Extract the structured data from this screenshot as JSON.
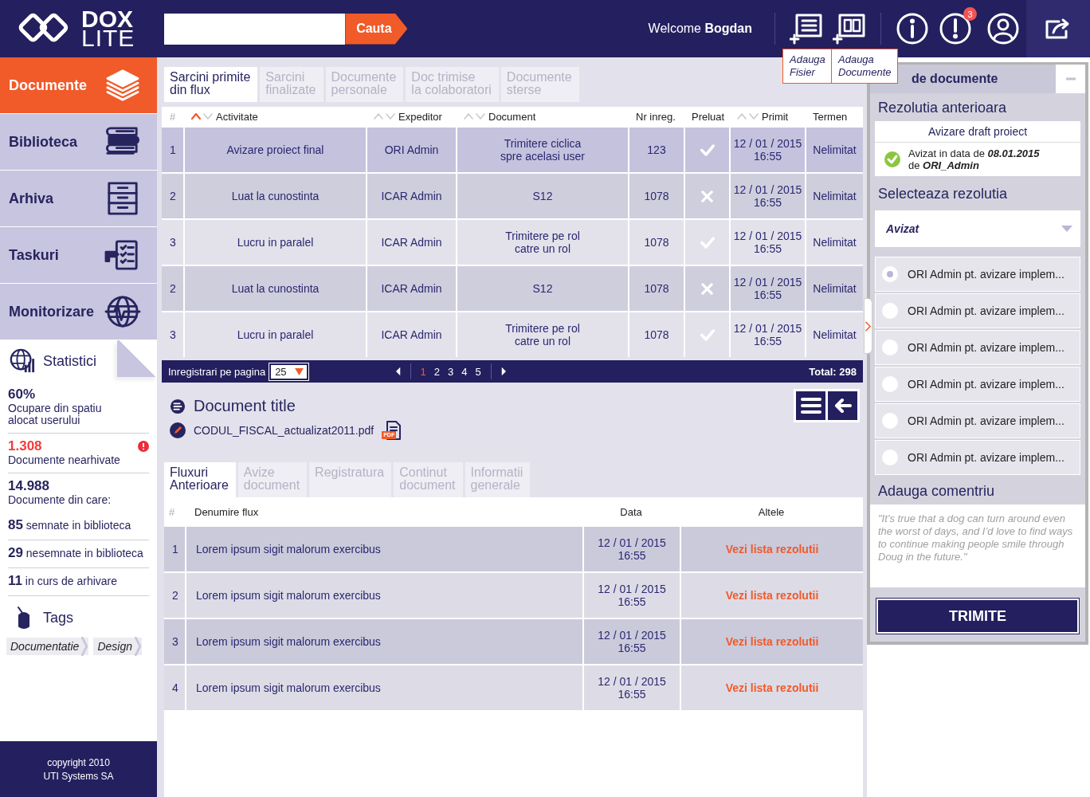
{
  "header": {
    "logo_top": "DOX",
    "logo_bottom": "LITE",
    "search": {
      "button": "Cauta"
    },
    "welcome": "Welcome **Bogdan**",
    "action_groups": [
      {
        "actions": [
          {
            "kind": "add-file",
            "tooltip": "Adauga\nFisier"
          },
          {
            "kind": "add-documents",
            "tooltip": "Adauga\nDocumente"
          }
        ]
      },
      {
        "actions": [
          {
            "kind": "info"
          },
          {
            "kind": "alert",
            "badge": "3"
          },
          {
            "kind": "user"
          }
        ]
      },
      {
        "actions": [
          {
            "kind": "logout"
          }
        ]
      }
    ]
  },
  "sidebar": {
    "items": [
      {
        "label": "Documente",
        "selected": true
      },
      {
        "label": "Biblioteca",
        "selected": false
      },
      {
        "label": "Arhiva",
        "selected": false
      },
      {
        "label": "Taskuri",
        "selected": false
      },
      {
        "label": "Monitorizare",
        "selected": false
      }
    ],
    "stats": {
      "title": "Statistici",
      "items": [
        {
          "kind": "stacked",
          "value": "60%",
          "label": "Ocupare din spatiu\nalocat userului",
          "alert": false,
          "divider": true
        },
        {
          "kind": "stacked",
          "value": "1.308",
          "label": "Documente nearhivate",
          "alert": true,
          "divider": true
        },
        {
          "kind": "stacked",
          "value": "14.988",
          "label": "Documente din care:",
          "alert": false,
          "divider": false
        },
        {
          "kind": "inline",
          "value": "85",
          "label": "semnate in biblioteca",
          "alert": false,
          "divider": true
        },
        {
          "kind": "inline",
          "value": "29",
          "label": "nesemnate in biblioteca",
          "alert": false,
          "divider": true
        },
        {
          "kind": "inline",
          "value": "11",
          "label": "in curs de arhivare",
          "alert": false,
          "divider": true
        }
      ]
    },
    "tags": {
      "title": "Tags",
      "items": [
        "Documentatie",
        "Design"
      ]
    },
    "footer": [
      "copyright 2010",
      "UTI Systems SA"
    ]
  },
  "tasks": {
    "tabs": [
      {
        "label": "Sarcini primite\ndin flux",
        "selected": true
      },
      {
        "label": "Sarcini\nfinalizate",
        "selected": false
      },
      {
        "label": "Documente\npersonale",
        "selected": false
      },
      {
        "label": "Doc trimise\nla colaboratori",
        "selected": false
      },
      {
        "label": "Documente\nsterse",
        "selected": false
      }
    ],
    "columns": [
      {
        "label": "#",
        "sortable": false
      },
      {
        "label": "Activitate",
        "sortable": true,
        "sort_active": true
      },
      {
        "label": "Expeditor",
        "sortable": true,
        "sort_active": false
      },
      {
        "label": "Document",
        "sortable": true,
        "sort_active": false
      },
      {
        "label": "Nr inreg.",
        "sortable": false
      },
      {
        "label": "Preluat",
        "sortable": false
      },
      {
        "label": "Primit",
        "sortable": true,
        "sort_active": false
      },
      {
        "label": "Termen",
        "sortable": false
      }
    ],
    "rows": [
      {
        "nr": "1",
        "activitate": "Avizare proiect final",
        "expeditor": "ORI Admin",
        "document": "Trimitere ciclica\nspre acelasi user",
        "nr_inreg": "123",
        "preluat": true,
        "primit": "12 / 01 / 2015\n16:55",
        "termen": "Nelimitat",
        "selected": true
      },
      {
        "nr": "2",
        "activitate": "Luat la cunostinta",
        "expeditor": "ICAR Admin",
        "document": "S12",
        "nr_inreg": "1078",
        "preluat": false,
        "primit": "12 / 01 / 2015\n16:55",
        "termen": "Nelimitat",
        "selected": false
      },
      {
        "nr": "3",
        "activitate": "Lucru in paralel",
        "expeditor": "ICAR Admin",
        "document": "Trimitere pe rol\ncatre un rol",
        "nr_inreg": "1078",
        "preluat": true,
        "primit": "12 / 01 / 2015\n16:55",
        "termen": "Nelimitat",
        "selected": false
      },
      {
        "nr": "2",
        "activitate": "Luat la cunostinta",
        "expeditor": "ICAR Admin",
        "document": "S12",
        "nr_inreg": "1078",
        "preluat": false,
        "primit": "12 / 01 / 2015\n16:55",
        "termen": "Nelimitat",
        "selected": false
      },
      {
        "nr": "3",
        "activitate": "Lucru in paralel",
        "expeditor": "ICAR Admin",
        "document": "Trimitere pe rol\ncatre un rol",
        "nr_inreg": "1078",
        "preluat": true,
        "primit": "12 / 01 / 2015\n16:55",
        "termen": "Nelimitat",
        "selected": false
      }
    ],
    "pagination": {
      "label": "Inregistrari pe pagina",
      "per_page": "25",
      "pages": [
        {
          "label": "1",
          "selected": true
        },
        {
          "label": "2",
          "selected": false
        },
        {
          "label": "3",
          "selected": false
        },
        {
          "label": "4",
          "selected": false
        },
        {
          "label": "5",
          "selected": false
        }
      ],
      "total": "Total: **298**"
    }
  },
  "document": {
    "title": "Document title",
    "file": "CODUL_FISCAL_actualizat2011.pdf",
    "file_badge": "PDF",
    "tabs": [
      {
        "label": "Fluxuri\nAnterioare",
        "selected": true
      },
      {
        "label": "Avize\ndocument",
        "selected": false
      },
      {
        "label": "Registratura",
        "selected": false
      },
      {
        "label": "Continut\ndocument",
        "selected": false
      },
      {
        "label": "Informatii\ngenerale",
        "selected": false
      }
    ],
    "columns": [
      "#",
      "Denumire flux",
      "Data",
      "Altele"
    ],
    "rows": [
      {
        "nr": "1",
        "name": "Lorem ipsum sigit malorum exercibus",
        "date": "12 / 01 / 2015\n16:55",
        "link": "Vezi lista rezolutii"
      },
      {
        "nr": "2",
        "name": "Lorem ipsum sigit malorum exercibus",
        "date": "12 / 01 / 2015\n16:55",
        "link": "Vezi lista rezolutii"
      },
      {
        "nr": "3",
        "name": "Lorem ipsum sigit malorum exercibus",
        "date": "12 / 01 / 2015\n16:55",
        "link": "Vezi lista rezolutii"
      },
      {
        "nr": "4",
        "name": "Lorem ipsum sigit malorum exercibus",
        "date": "12 / 01 / 2015\n16:55",
        "link": "Vezi lista rezolutii"
      }
    ]
  },
  "panel": {
    "title": "de documente",
    "previous": {
      "heading": "Rezolutia anterioara",
      "name": "Avizare draft proiect",
      "status": "Avizat in data de **08.01.2015**\nde **ORI_Admin**"
    },
    "select": {
      "heading": "Selecteaza rezolutia",
      "value": "Avizat"
    },
    "options": [
      {
        "label": "ORI Admin pt. avizare implem...",
        "selected": true
      },
      {
        "label": "ORI Admin pt. avizare implem...",
        "selected": false
      },
      {
        "label": "ORI Admin pt. avizare implem...",
        "selected": false
      },
      {
        "label": "ORI Admin pt. avizare implem...",
        "selected": false
      },
      {
        "label": "ORI Admin pt. avizare implem...",
        "selected": false
      },
      {
        "label": "ORI Admin pt. avizare implem...",
        "selected": false
      }
    ],
    "comment": {
      "heading": "Adauga comentriu",
      "placeholder": "\"It’s true that a dog can turn around even the worst of days, and I’d love to find ways to continue making people smile through Doug in the future.\""
    },
    "submit": "TRIMITE"
  }
}
